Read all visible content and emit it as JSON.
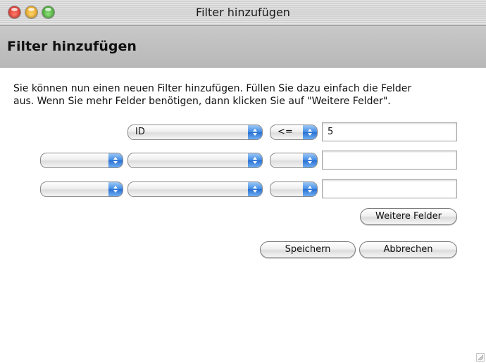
{
  "window": {
    "title": "Filter hinzufügen"
  },
  "header": {
    "title": "Filter hinzufügen"
  },
  "intro": {
    "line1": "Sie können nun einen neuen Filter hinzufügen. Füllen Sie dazu einfach die Felder",
    "line2": "aus. Wenn Sie mehr Felder benötigen, dann klicken Sie auf \"Weitere Felder\"."
  },
  "filter_rows": [
    {
      "field": "ID",
      "operator": "<=",
      "value": "5"
    },
    {
      "connector": "",
      "field": "",
      "operator": "",
      "value": ""
    },
    {
      "connector": "",
      "field": "",
      "operator": "",
      "value": ""
    }
  ],
  "buttons": {
    "more_fields": "Weitere Felder",
    "save": "Speichern",
    "cancel": "Abbrechen"
  },
  "colors": {
    "accent": "#3f8ae6",
    "header_band": "#bdbdbd"
  }
}
